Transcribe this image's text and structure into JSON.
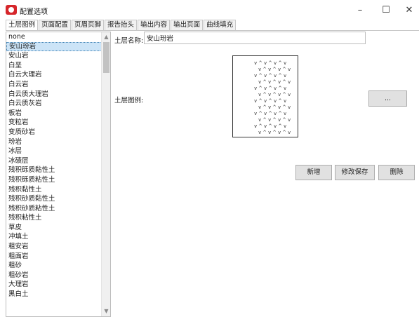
{
  "window": {
    "title": "配置选项",
    "minimize_label": "–",
    "maximize_label": "☐",
    "close_label": "✕"
  },
  "tabs": [
    {
      "label": "土层图例",
      "active": true
    },
    {
      "label": "页面配置"
    },
    {
      "label": "页眉页脚"
    },
    {
      "label": "报告抬头"
    },
    {
      "label": "输出内容"
    },
    {
      "label": "输出页面"
    },
    {
      "label": "曲线填充"
    }
  ],
  "layer_list": {
    "selected_index": 1,
    "items": [
      "none",
      "安山玢岩",
      "安山岩",
      "白垩",
      "白云大理岩",
      "白云岩",
      "白云质大理岩",
      "白云质灰岩",
      "板岩",
      "变粒岩",
      "变质砂岩",
      "玢岩",
      "冰层",
      "冰碛层",
      "残积砾质黏性土",
      "残积砾质粘性土",
      "残积黏性土",
      "残积砂质黏性土",
      "残积砂质粘性土",
      "残积粘性土",
      "草皮",
      "冲填土",
      "粗安岩",
      "粗面岩",
      "粗砂",
      "粗砂岩",
      "大理岩",
      "黑白土"
    ],
    "scroll_up_icon": "chevron-up-icon",
    "scroll_down_icon": "chevron-down-icon"
  },
  "form": {
    "name_label": "土层名称:",
    "name_value": "安山玢岩",
    "legend_label": "土层图例:",
    "browse_label": "..."
  },
  "actions": {
    "add_label": "新增",
    "save_label": "修改保存",
    "delete_label": "删除"
  },
  "colors": {
    "app_icon": "#d6262b",
    "selection": "#cce4f7",
    "button_face": "#e1e1e1"
  }
}
